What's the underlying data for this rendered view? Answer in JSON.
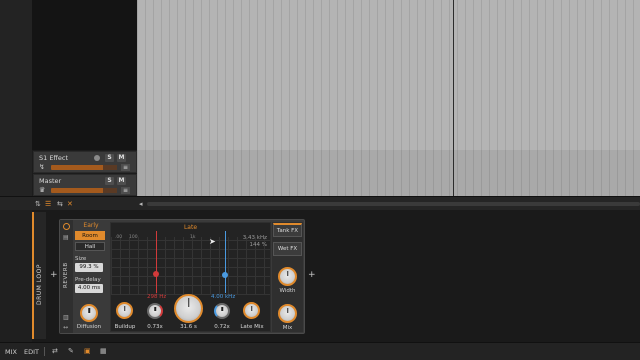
{
  "colors": {
    "accent": "#e08a2c",
    "low_cut": "#d13a3a",
    "high_cut": "#4a9ae0"
  },
  "tracks": [
    {
      "name": "S1 Effect",
      "solo": "S",
      "mute": "M"
    },
    {
      "name": "Master",
      "solo": "S",
      "mute": "M"
    }
  ],
  "device_chain": {
    "name": "DRUM LOOP"
  },
  "device": {
    "name": "REVERB",
    "early": {
      "title": "Early",
      "modes": [
        {
          "label": "Room",
          "active": true
        },
        {
          "label": "Hall",
          "active": false
        }
      ],
      "size_label": "Size",
      "size_value": "99.3 %",
      "predelay_label": "Pre-delay",
      "predelay_value": "4.00 ms"
    },
    "late": {
      "title": "Late",
      "ticks": [
        ".00",
        "100",
        "1k"
      ],
      "info_freq": "3.43 kHz",
      "info_pct": "144 %",
      "low_freq": "298 Hz",
      "high_freq": "4.00 kHz"
    },
    "knobs": [
      {
        "label": "Diffusion"
      },
      {
        "label": "Buildup"
      },
      {
        "label": "0.73x"
      },
      {
        "label": "31.6 s"
      },
      {
        "label": "0.72x"
      },
      {
        "label": "Late Mix"
      }
    ],
    "fx": {
      "tank": "Tank FX",
      "wet": "Wet FX",
      "width": "Width",
      "mix": "Mix"
    }
  },
  "statusbar": {
    "mix": "MIX",
    "edit": "EDIT"
  }
}
